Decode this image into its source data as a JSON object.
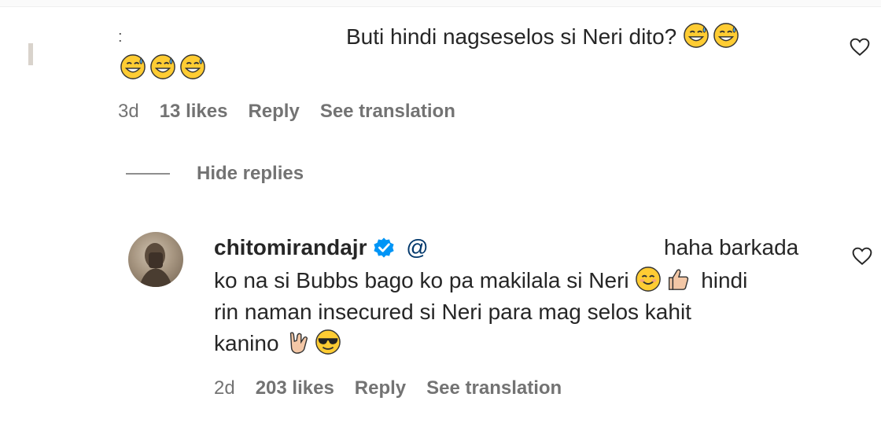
{
  "comment1": {
    "username_visible": "",
    "text_line1": "Buti hindi nagseselos si Neri dito?",
    "time": "3d",
    "likes": "13 likes",
    "reply_label": "Reply",
    "translation_label": "See translation",
    "emoji_line1": [
      "sweat-smile",
      "sweat-smile"
    ],
    "emoji_line2": [
      "sweat-smile",
      "sweat-smile",
      "sweat-smile"
    ]
  },
  "thread": {
    "hide_replies_label": "Hide replies"
  },
  "reply1": {
    "username": "chitomirandajr",
    "mention": "@",
    "line1_after_mention": "haha barkada",
    "line2_prefix": "ko na si Bubbs bago ko pa makilala si Neri",
    "line2_suffix": "hindi",
    "line3": "rin naman insecured si Neri para mag selos kahit",
    "line4": "kanino",
    "time": "2d",
    "likes": "203 likes",
    "reply_label": "Reply",
    "translation_label": "See translation"
  },
  "icons": {
    "heart": "heart-outline-icon",
    "verified": "verified-badge-icon",
    "emoji_smile": "smiling-face-icon",
    "emoji_thumbs": "thumbs-up-icon",
    "emoji_rock": "rock-on-hand-icon",
    "emoji_sunglasses": "sunglasses-face-icon"
  },
  "colors": {
    "text": "#262626",
    "secondary": "#737373",
    "verified": "#0095f6",
    "emoji": "#ffcc33"
  }
}
